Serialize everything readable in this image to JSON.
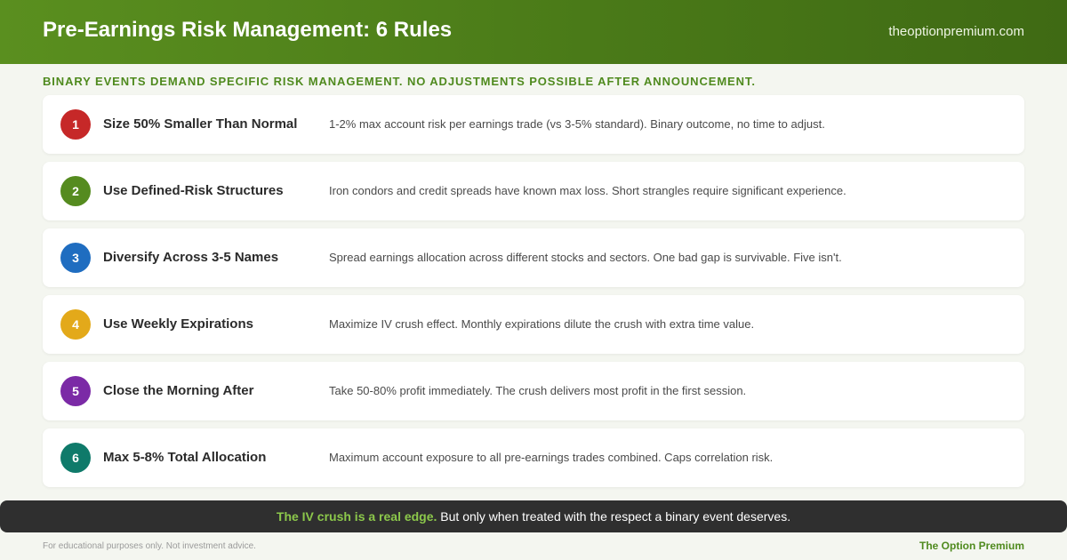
{
  "header": {
    "title": "Pre-Earnings Risk Management: 6 Rules",
    "site": "theoptionpremium.com"
  },
  "subtitle": "BINARY EVENTS DEMAND SPECIFIC RISK MANAGEMENT. NO ADJUSTMENTS POSSIBLE AFTER ANNOUNCEMENT.",
  "colors": {
    "header_green": "#4a7a18",
    "accent_green": "#4f8a1e",
    "rule_1": "#c62828",
    "rule_2": "#558b1f",
    "rule_3": "#1f6dc0",
    "rule_4": "#e3a91a",
    "rule_5": "#7b2aa6",
    "rule_6": "#0f7a6a",
    "banner_bg": "#2f2f2f",
    "banner_highlight": "#8cc84b"
  },
  "rules": [
    {
      "number": "1",
      "title": "Size 50% Smaller Than Normal",
      "description": "1-2% max account risk per earnings trade (vs 3-5% standard). Binary outcome, no time to adjust."
    },
    {
      "number": "2",
      "title": "Use Defined-Risk Structures",
      "description": "Iron condors and credit spreads have known max loss. Short strangles require significant experience."
    },
    {
      "number": "3",
      "title": "Diversify Across 3-5 Names",
      "description": "Spread earnings allocation across different stocks and sectors. One bad gap is survivable. Five isn't."
    },
    {
      "number": "4",
      "title": "Use Weekly Expirations",
      "description": "Maximize IV crush effect. Monthly expirations dilute the crush with extra time value."
    },
    {
      "number": "5",
      "title": "Close the Morning After",
      "description": "Take 50-80% profit immediately. The crush delivers most profit in the first session."
    },
    {
      "number": "6",
      "title": "Max 5-8% Total Allocation",
      "description": "Maximum account exposure to all pre-earnings trades combined. Caps correlation risk."
    }
  ],
  "banner": {
    "highlight": "The IV crush is a real edge.",
    "rest": " But only when treated with the respect a binary event deserves."
  },
  "footer": {
    "disclaimer": "For educational purposes only. Not investment advice.",
    "brand": "The Option Premium"
  }
}
